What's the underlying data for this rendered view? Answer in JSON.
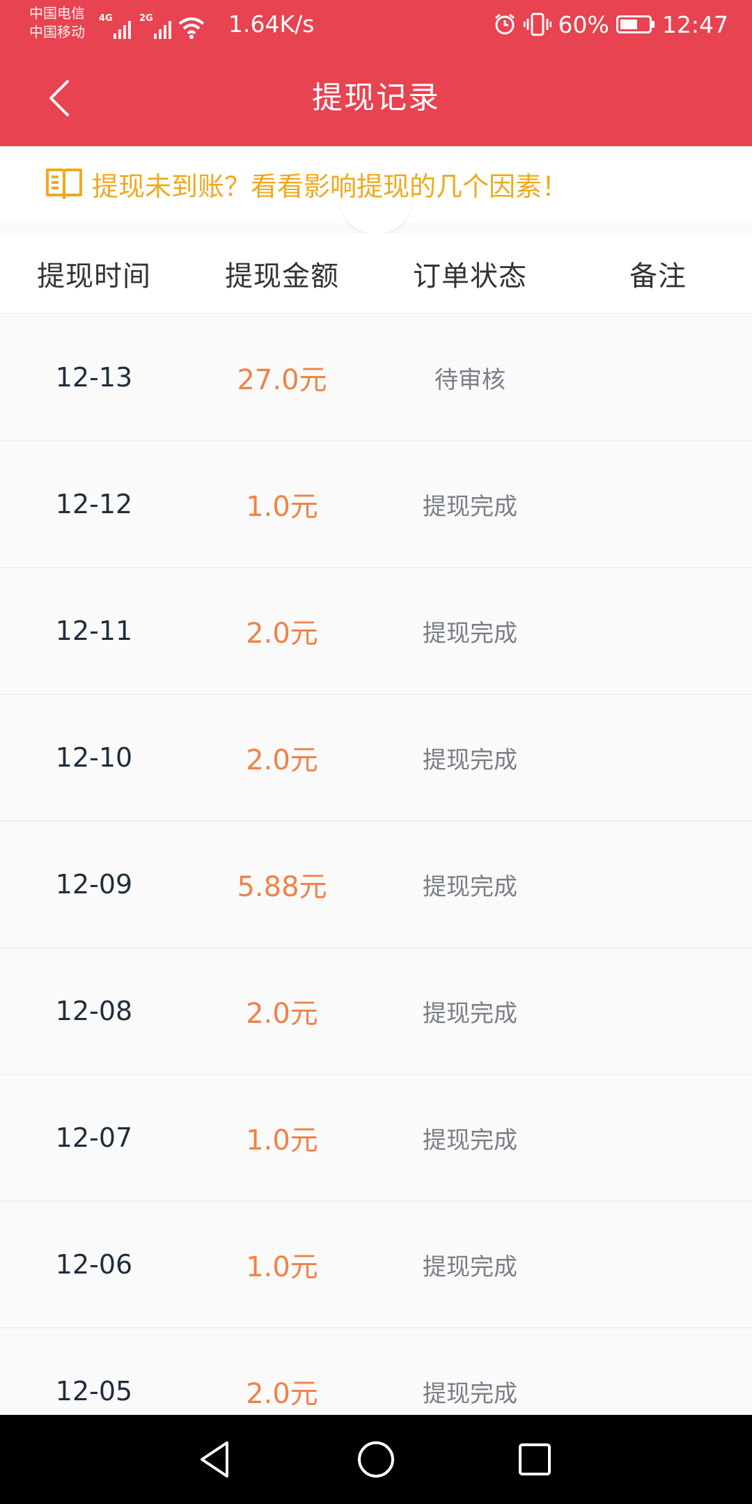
{
  "status_bar": {
    "carrier1": "中国电信",
    "carrier2": "中国移动",
    "network1": "4G",
    "network2": "2G",
    "speed": "1.64K/s",
    "battery_pct": "60%",
    "time": "12:47"
  },
  "header": {
    "title": "提现记录",
    "back_icon": "chevron-left-icon"
  },
  "notice": {
    "text": "提现未到账？看看影响提现的几个因素！",
    "icon": "book-icon"
  },
  "table": {
    "headers": [
      "提现时间",
      "提现金额",
      "订单状态",
      "备注"
    ],
    "rows": [
      {
        "date": "12-13",
        "amount": "27.0元",
        "status": "待审核",
        "remark": ""
      },
      {
        "date": "12-12",
        "amount": "1.0元",
        "status": "提现完成",
        "remark": ""
      },
      {
        "date": "12-11",
        "amount": "2.0元",
        "status": "提现完成",
        "remark": ""
      },
      {
        "date": "12-10",
        "amount": "2.0元",
        "status": "提现完成",
        "remark": ""
      },
      {
        "date": "12-09",
        "amount": "5.88元",
        "status": "提现完成",
        "remark": ""
      },
      {
        "date": "12-08",
        "amount": "2.0元",
        "status": "提现完成",
        "remark": ""
      },
      {
        "date": "12-07",
        "amount": "1.0元",
        "status": "提现完成",
        "remark": ""
      },
      {
        "date": "12-06",
        "amount": "1.0元",
        "status": "提现完成",
        "remark": ""
      },
      {
        "date": "12-05",
        "amount": "2.0元",
        "status": "提现完成",
        "remark": ""
      }
    ]
  },
  "colors": {
    "brand_red": "#e84351",
    "amount_orange": "#f08247",
    "notice_yellow": "#f0a81d"
  },
  "navbar": {
    "buttons": [
      "back-triangle-icon",
      "home-circle-icon",
      "recents-square-icon"
    ]
  }
}
